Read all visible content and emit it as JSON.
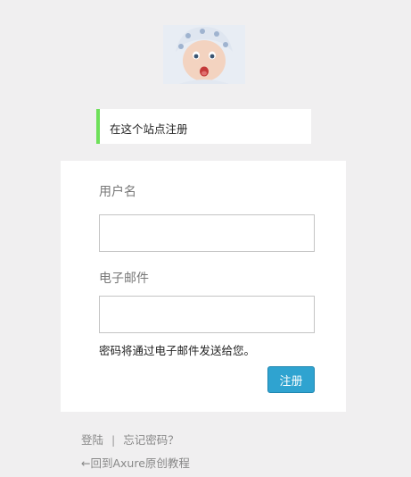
{
  "notice": {
    "text": "在这个站点注册"
  },
  "form": {
    "username_label": "用户名",
    "username_value": "",
    "email_label": "电子邮件",
    "email_value": "",
    "hint": "密码将通过电子邮件发送给您。",
    "submit_label": "注册"
  },
  "footer": {
    "login_label": "登陆",
    "separator": "|",
    "forgot_label": "忘记密码？",
    "back_label": "←回到Axure原创教程"
  },
  "colors": {
    "background": "#f0eff0",
    "notice_accent": "#6ee05a",
    "button": "#2fa3d0"
  },
  "icons": {
    "avatar": "baby-photo-avatar"
  }
}
